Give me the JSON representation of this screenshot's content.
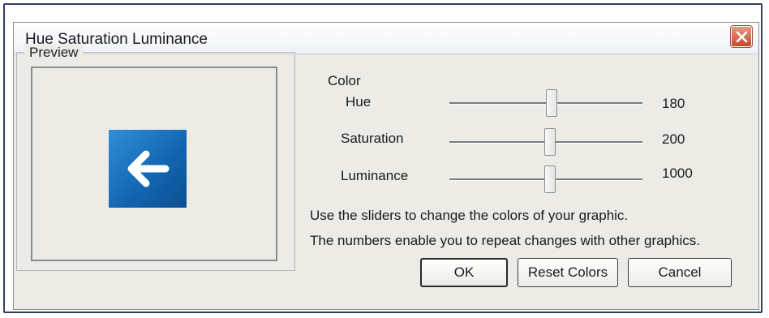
{
  "window": {
    "title": "Hue Saturation Luminance",
    "close_icon": "close-icon"
  },
  "preview": {
    "legend": "Preview",
    "graphic_icon": "left-arrow-icon",
    "colors": {
      "tile_start": "#2f8fd6",
      "tile_end": "#0d4f90"
    }
  },
  "color_section": {
    "heading": "Color",
    "sliders": [
      {
        "label": "Hue",
        "value": "180",
        "position_fraction": 0.53
      },
      {
        "label": "Saturation",
        "value": "200",
        "position_fraction": 0.52
      },
      {
        "label": "Luminance",
        "value": "1000",
        "position_fraction": 0.52
      }
    ]
  },
  "info": {
    "line1": "Use the sliders to change the colors of your graphic.",
    "line2": "The numbers enable you to repeat changes with other graphics."
  },
  "buttons": {
    "ok": "OK",
    "reset": "Reset Colors",
    "cancel": "Cancel"
  }
}
